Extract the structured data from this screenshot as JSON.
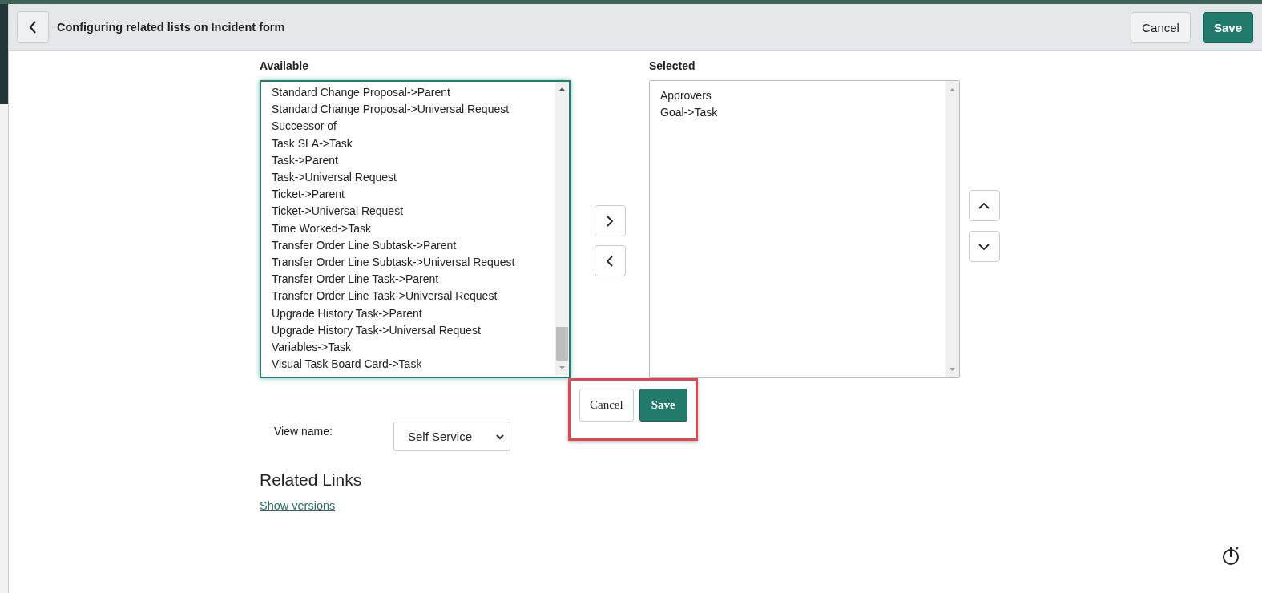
{
  "header": {
    "title": "Configuring related lists on Incident form",
    "buttons": [
      "Cancel",
      "Save"
    ]
  },
  "available": {
    "label": "Available",
    "items": [
      "Standard Change Proposal->Parent",
      "Standard Change Proposal->Universal Request",
      "Successor of",
      "Task SLA->Task",
      "Task->Parent",
      "Task->Universal Request",
      "Ticket->Parent",
      "Ticket->Universal Request",
      "Time Worked->Task",
      "Transfer Order Line Subtask->Parent",
      "Transfer Order Line Subtask->Universal Request",
      "Transfer Order Line Task->Parent",
      "Transfer Order Line Task->Universal Request",
      "Upgrade History Task->Parent",
      "Upgrade History Task->Universal Request",
      "Variables->Task",
      "Visual Task Board Card->Task"
    ]
  },
  "selected": {
    "label": "Selected",
    "items": [
      "Approvers",
      "Goal->Task"
    ]
  },
  "form_buttons": [
    "Cancel",
    "Save"
  ],
  "view": {
    "label": "View name:",
    "value": "Self Service"
  },
  "related_links": {
    "title": "Related Links",
    "links": [
      "Show versions"
    ]
  }
}
